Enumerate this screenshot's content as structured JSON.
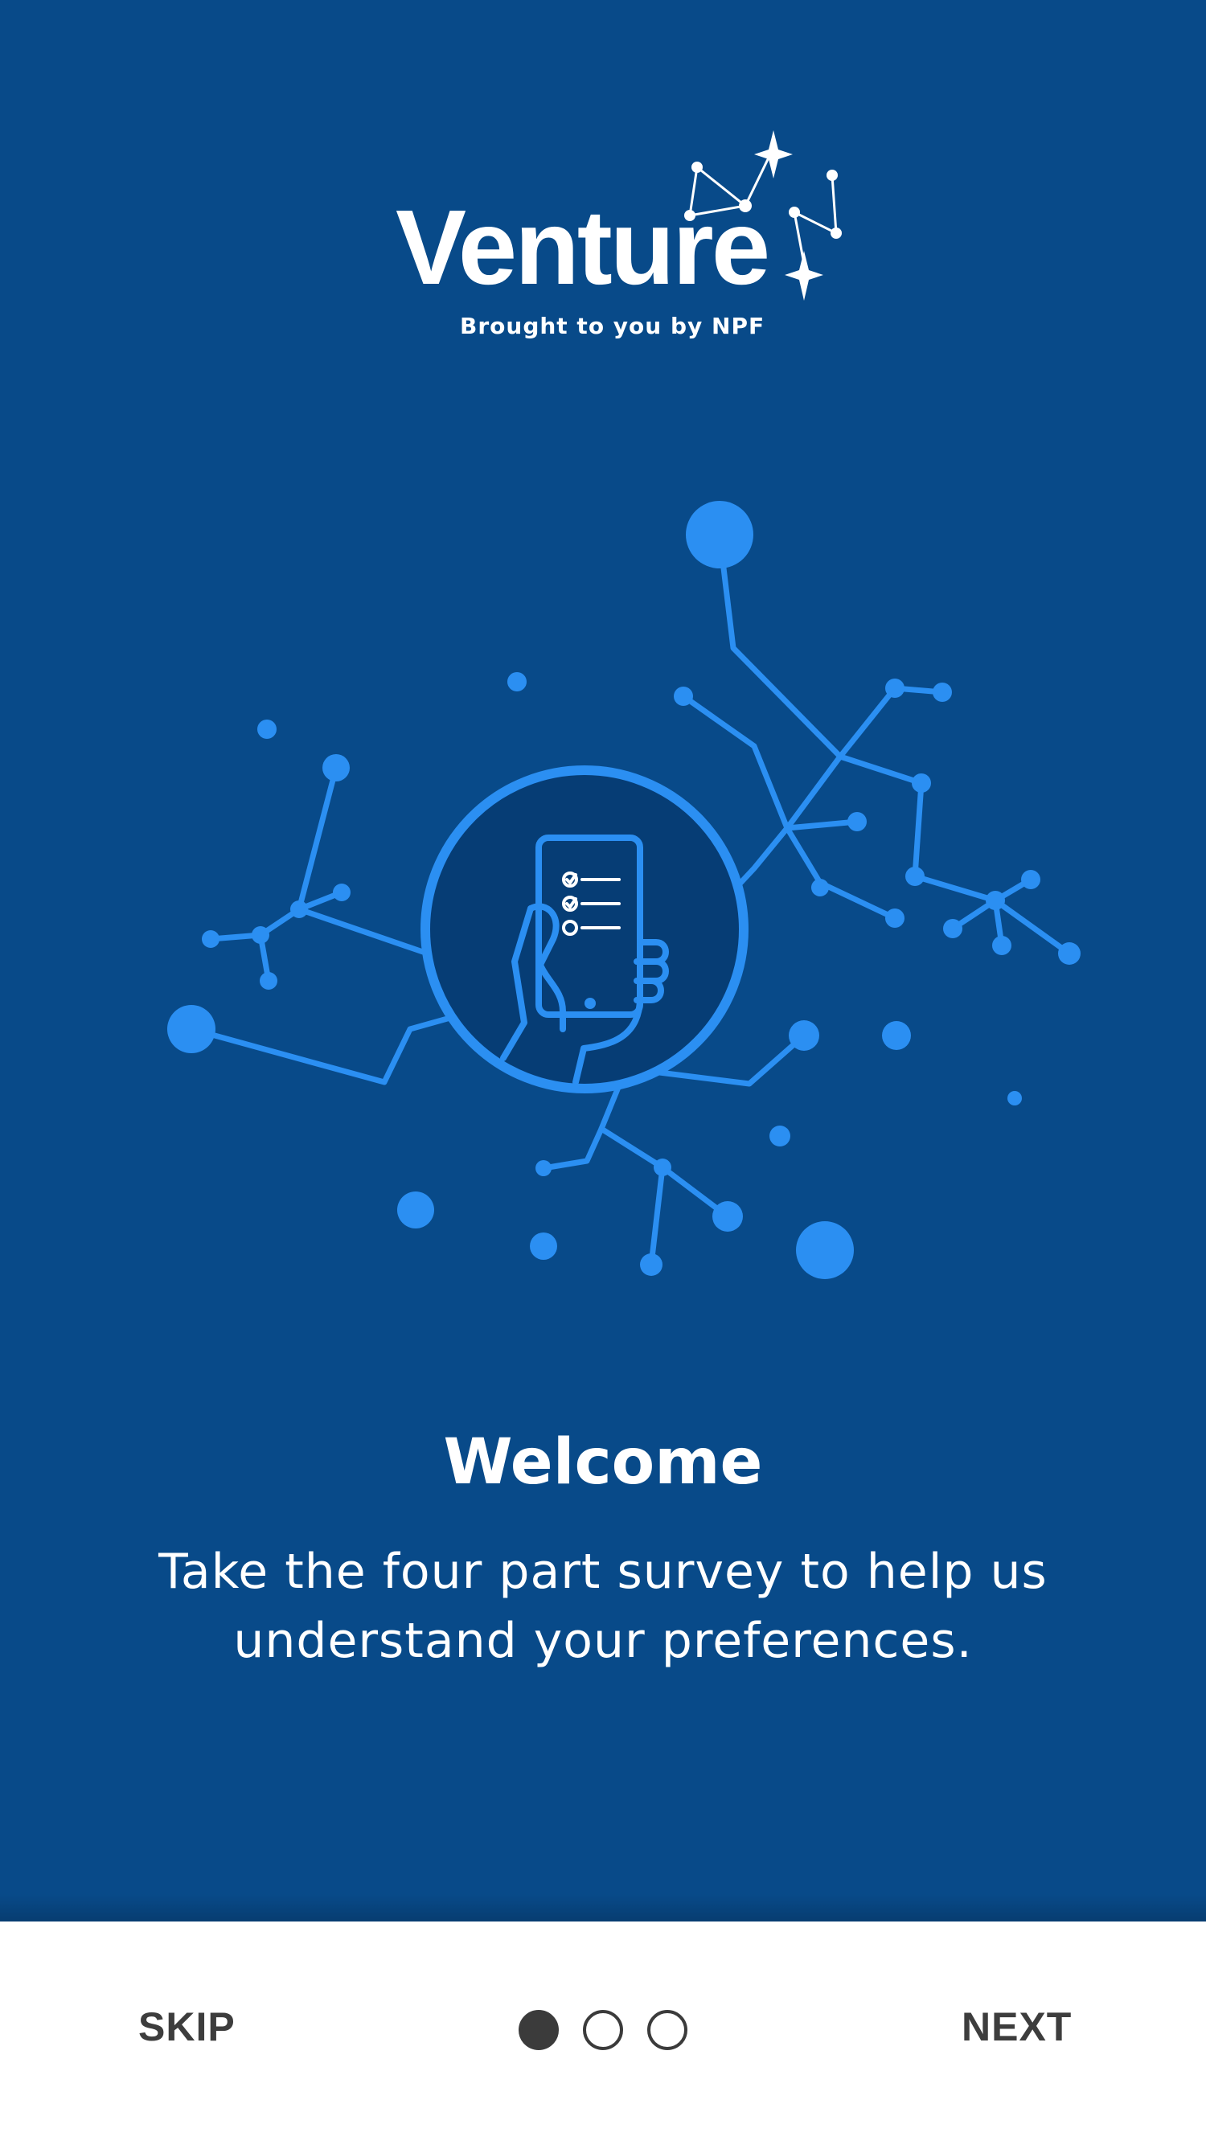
{
  "logo": {
    "wordmark": "Venture",
    "tagline": "Brought to you by NPF"
  },
  "illustration": {
    "icon": "phone-survey-icon"
  },
  "content": {
    "title": "Welcome",
    "body": "Take the four part survey to help us understand your preferences."
  },
  "footer": {
    "skip_label": "SKIP",
    "next_label": "NEXT",
    "pager": {
      "total": 3,
      "current": 1
    }
  },
  "colors": {
    "background": "#084a89",
    "accent": "#2b8ff2",
    "footer_bg": "#ffffff",
    "footer_text": "#3d3d3d"
  }
}
